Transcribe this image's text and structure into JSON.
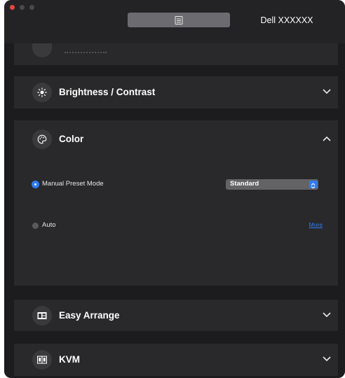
{
  "window": {
    "tab_icon": "list-icon",
    "device_label": "Dell XXXXXX"
  },
  "panels": {
    "brightness": {
      "title": "Brightness / Contrast",
      "icon": "sun-icon",
      "expanded": false
    },
    "color": {
      "title": "Color",
      "icon": "palette-icon",
      "expanded": true,
      "options": [
        {
          "label": "Manual Preset Mode",
          "selected": true
        },
        {
          "label": "Auto",
          "selected": false
        }
      ],
      "preset_select": {
        "value": "Standard"
      },
      "more_link": "More"
    },
    "easy_arrange": {
      "title": "Easy Arrange",
      "icon": "layout-icon",
      "expanded": false
    },
    "kvm": {
      "title": "KVM",
      "icon": "kvm-icon",
      "expanded": false
    }
  },
  "colors": {
    "accent": "#2f7cf6",
    "close": "#e2463f",
    "panel": "#29292b",
    "background": "#1c1c1e"
  }
}
